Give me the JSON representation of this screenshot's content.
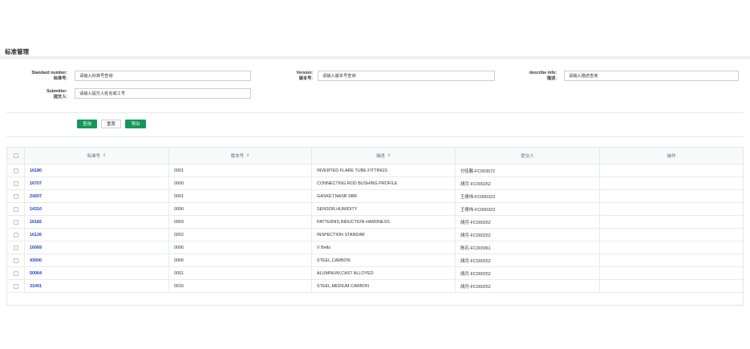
{
  "page": {
    "title": "标准管理"
  },
  "form": {
    "standard_number": {
      "label_en": "Standard number:",
      "label_cn": "标准号:",
      "placeholder": "请输入标准号查询"
    },
    "version": {
      "label_en": "Version:",
      "label_cn": "版本号:",
      "placeholder": "请输入版本号查询"
    },
    "describe": {
      "label_en": "describe info:",
      "label_cn": "描述:",
      "placeholder": "请输入描述查询"
    },
    "submitter": {
      "label_en": "Submitter:",
      "label_cn": "提交人:",
      "placeholder": "请输入提交人姓名或工号"
    }
  },
  "buttons": {
    "query": "查询",
    "reset": "重置",
    "export": "导出"
  },
  "colors": {
    "primary": "#16965a",
    "link": "#1a3fc0"
  },
  "table": {
    "columns": [
      {
        "label": "标准号",
        "sort_icon": "⇕"
      },
      {
        "label": "版本号",
        "sort_icon": "⇕"
      },
      {
        "label": "描述",
        "sort_icon": "⇕"
      },
      {
        "label": "提交人",
        "sort_icon": ""
      },
      {
        "label": "操作",
        "sort_icon": ""
      }
    ],
    "rows": [
      {
        "standard": "16180",
        "version": "0001",
        "describe": "INVERTED FLARE TUBE FITTINGS",
        "submitter": "付佳鹏-FC003672"
      },
      {
        "standard": "16707",
        "version": "0000",
        "describe": "CONNECTING ROD BUSHING PROFILE",
        "submitter": "胡月-FC000252"
      },
      {
        "standard": "24207",
        "version": "0001",
        "describe": "GASKET,NASB SBR",
        "submitter": "王倚伟-FC000323"
      },
      {
        "standard": "14310",
        "version": "0006",
        "describe": "SENSOR,HUMIDITY",
        "submitter": "王倚伟-FC000323"
      },
      {
        "standard": "16182",
        "version": "0003",
        "describe": "PATTERNS,INDUCTION HARDNESS",
        "submitter": "胡月-FC000252"
      },
      {
        "standard": "16126",
        "version": "0002",
        "describe": "INSPECTION STANDAR",
        "submitter": "胡月-FC000252"
      },
      {
        "standard": "16069",
        "version": "0006",
        "describe": "V Belts",
        "submitter": "陈石-FC003061"
      },
      {
        "standard": "43000",
        "version": "0006",
        "describe": "STEEL,CARBON",
        "submitter": "胡月-FC000252"
      },
      {
        "standard": "50064",
        "version": "0001",
        "describe": "ALUMINUM,CAST ALLOYED",
        "submitter": "胡月-FC000252"
      },
      {
        "standard": "31001",
        "version": "0015",
        "describe": "STEEL,MEDIUM CARBON",
        "submitter": "胡月-FC000252"
      }
    ]
  }
}
